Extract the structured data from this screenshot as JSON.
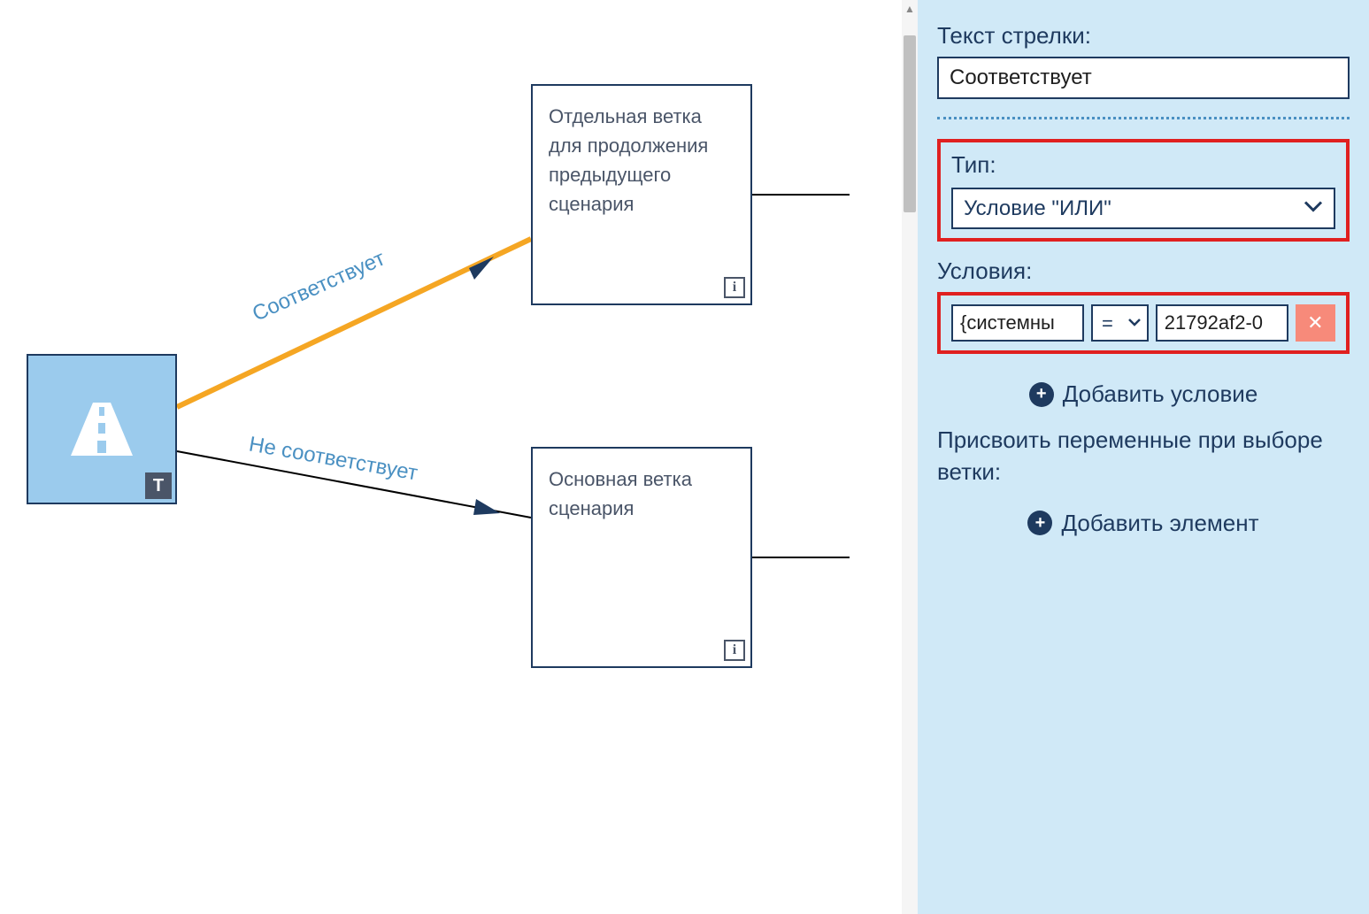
{
  "sidebar": {
    "arrow_text_label": "Текст стрелки:",
    "arrow_text_value": "Соответствует",
    "type_label": "Тип:",
    "type_value": "Условие \"ИЛИ\"",
    "conditions_label": "Условия:",
    "condition": {
      "left": "{системны",
      "operator": "=",
      "right": "21792af2-0"
    },
    "add_condition": "Добавить условие",
    "assign_vars_label": "Присвоить переменные при выборе ветки:",
    "add_element": "Добавить элемент"
  },
  "diagram": {
    "start_badge": "Т",
    "node_top_text": "Отдельная ветка для продолжения предыдущего сценария",
    "node_bottom_text": "Основная ветка сценария",
    "edge_top_label": "Соответствует",
    "edge_bottom_label": "Не соответствует",
    "info_symbol": "i"
  }
}
